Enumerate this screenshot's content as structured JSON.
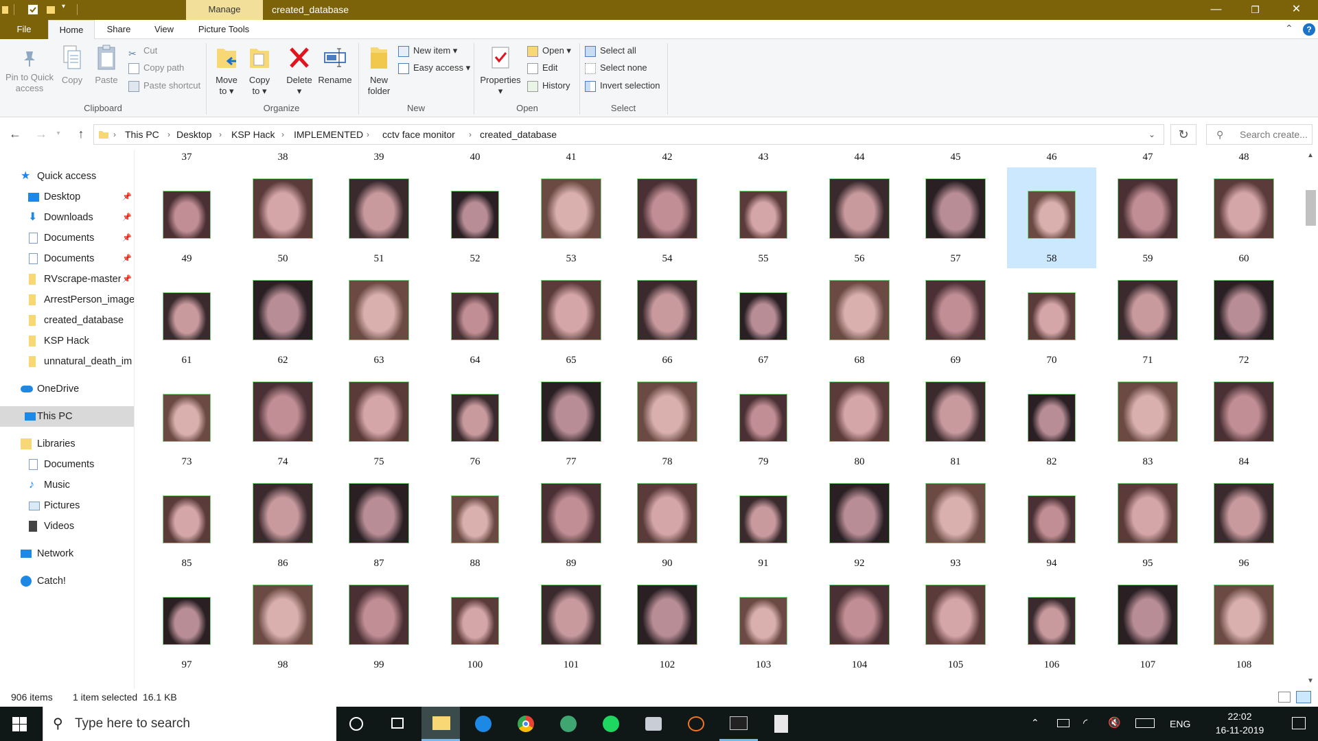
{
  "window": {
    "manage_label": "Manage",
    "title": "created_database",
    "minimize": "—",
    "maximize": "❐",
    "close": "✕"
  },
  "ribbon_tabs": [
    "File",
    "Home",
    "Share",
    "View",
    "Picture Tools"
  ],
  "ribbon": {
    "clipboard": {
      "pin_l1": "Pin to Quick",
      "pin_l2": "access",
      "copy": "Copy",
      "paste": "Paste",
      "cut": "Cut",
      "copy_path": "Copy path",
      "paste_shortcut": "Paste shortcut",
      "group": "Clipboard"
    },
    "organize": {
      "move_l1": "Move",
      "move_l2": "to ▾",
      "copyto_l1": "Copy",
      "copyto_l2": "to ▾",
      "delete": "Delete",
      "delete_l2": "▾",
      "rename": "Rename",
      "group": "Organize"
    },
    "new": {
      "folder_l1": "New",
      "folder_l2": "folder",
      "new_item": "New item ▾",
      "easy_access": "Easy access ▾",
      "group": "New"
    },
    "open": {
      "properties": "Properties",
      "properties_l2": "▾",
      "open": "Open ▾",
      "edit": "Edit",
      "history": "History",
      "group": "Open"
    },
    "select": {
      "select_all": "Select all",
      "select_none": "Select none",
      "invert": "Invert selection",
      "group": "Select"
    }
  },
  "address": {
    "crumbs": [
      "This PC",
      "Desktop",
      "KSP Hack",
      "IMPLEMENTED",
      "cctv face monitor",
      "created_database"
    ],
    "search_placeholder": "Search create..."
  },
  "nav": {
    "quick_access": "Quick access",
    "items": [
      {
        "label": "Desktop",
        "icon": "desktop-icon",
        "pinned": true
      },
      {
        "label": "Downloads",
        "icon": "download-icon",
        "pinned": true
      },
      {
        "label": "Documents",
        "icon": "document-icon",
        "pinned": true
      },
      {
        "label": "Documents",
        "icon": "document-icon",
        "pinned": true
      },
      {
        "label": "RVscrape-master",
        "icon": "folder-icon",
        "pinned": true
      },
      {
        "label": "ArrestPerson_image",
        "icon": "folder-icon",
        "pinned": false
      },
      {
        "label": "created_database",
        "icon": "folder-icon",
        "pinned": false
      },
      {
        "label": "KSP Hack",
        "icon": "folder-icon",
        "pinned": false
      },
      {
        "label": "unnatural_death_im",
        "icon": "folder-icon",
        "pinned": false
      }
    ],
    "onedrive": "OneDrive",
    "thispc": "This PC",
    "libraries": "Libraries",
    "lib_items": [
      {
        "label": "Documents",
        "icon": "document-icon"
      },
      {
        "label": "Music",
        "icon": "music-icon"
      },
      {
        "label": "Pictures",
        "icon": "pictures-icon"
      },
      {
        "label": "Videos",
        "icon": "videos-icon"
      }
    ],
    "network": "Network",
    "catch": "Catch!"
  },
  "files": {
    "first_row_start": 37,
    "last_number": 108,
    "selected": 58
  },
  "status": {
    "count": "906 items",
    "selection": "1 item selected  16.1 KB"
  },
  "taskbar": {
    "search_placeholder": "Type here to search",
    "lang": "ENG",
    "time": "22:02",
    "date": "16-11-2019"
  }
}
